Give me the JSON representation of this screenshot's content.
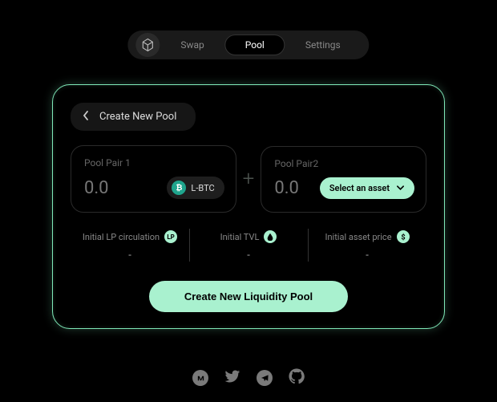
{
  "nav": {
    "items": [
      "Swap",
      "Pool",
      "Settings"
    ],
    "activeIndex": 1
  },
  "card": {
    "title": "Create New Pool",
    "pair1": {
      "label": "Pool Pair 1",
      "value": "0.0",
      "asset": "L-BTC"
    },
    "pair2": {
      "label": "Pool Pair2",
      "value": "0.0",
      "selectLabel": "Select an asset"
    },
    "stats": {
      "lp": {
        "label": "Initial LP circulation",
        "value": "-"
      },
      "tvl": {
        "label": "Initial TVL",
        "value": "-"
      },
      "price": {
        "label": "Initial asset price",
        "value": "-"
      }
    },
    "cta": "Create New Liquidity Pool"
  },
  "colors": {
    "accent": "#a9f1cf",
    "border": "#7fe8b8"
  }
}
